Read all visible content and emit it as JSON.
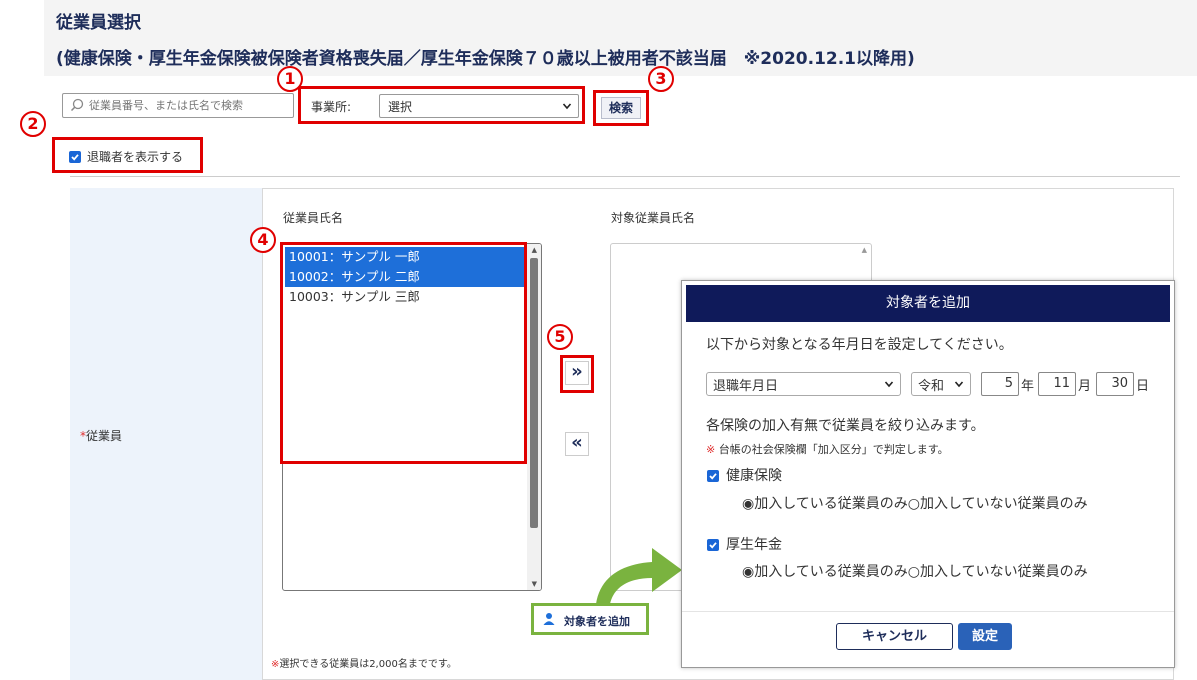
{
  "header": {
    "title": "従業員選択",
    "subtitle": "(健康保険・厚生年金保険被保険者資格喪失届／厚生年金保険７０歳以上被用者不該当届　※2020.12.1以降用)"
  },
  "toolbar": {
    "search_placeholder": "従業員番号、または氏名で検索",
    "office_label": "事業所:",
    "office_value": "選択",
    "search_button": "検索",
    "show_retired_label": "退職者を表示する",
    "show_retired_checked": true
  },
  "markers": {
    "m1": "1",
    "m2": "2",
    "m3": "3",
    "m4": "4",
    "m5": "5"
  },
  "form": {
    "required_mark": "*",
    "field_label": "従業員",
    "employee_list_header": "従業員氏名",
    "target_list_header": "対象従業員氏名",
    "employees": [
      {
        "label": "10001：サンプル 一郎",
        "selected": true
      },
      {
        "label": "10002：サンプル 二郎",
        "selected": true
      },
      {
        "label": "10003：サンプル 三郎",
        "selected": false
      }
    ],
    "move_right": "»",
    "move_left": "«",
    "note_mark": "※",
    "note": "選択できる従業員は2,000名までです。",
    "add_target_button": "対象者を追加"
  },
  "modal": {
    "title": "対象者を追加",
    "instruction": "以下から対象となる年月日を設定してください。",
    "date_type": "退職年月日",
    "era": "令和",
    "year": "5",
    "year_unit": "年",
    "month": "11",
    "month_unit": "月",
    "day": "30",
    "day_unit": "日",
    "filter_text": "各保険の加入有無で従業員を絞り込みます。",
    "note_mark": "※",
    "note": "台帳の社会保険欄「加入区分」で判定します。",
    "health": {
      "label": "健康保険",
      "checked": true,
      "opt_joined": "◉加入している従業員のみ",
      "opt_not_joined": "○加入していない従業員のみ"
    },
    "pension": {
      "label": "厚生年金",
      "checked": true,
      "opt_joined": "◉加入している従業員のみ",
      "opt_not_joined": "○加入していない従業員のみ"
    },
    "cancel_button": "キャンセル",
    "ok_button": "設定"
  },
  "colors": {
    "header_navy": "#1e2d5a",
    "modal_header": "#0f1a5a",
    "selection_blue": "#1e6fd9",
    "annotation_red": "#e00000",
    "annotation_green": "#7ab33f"
  }
}
